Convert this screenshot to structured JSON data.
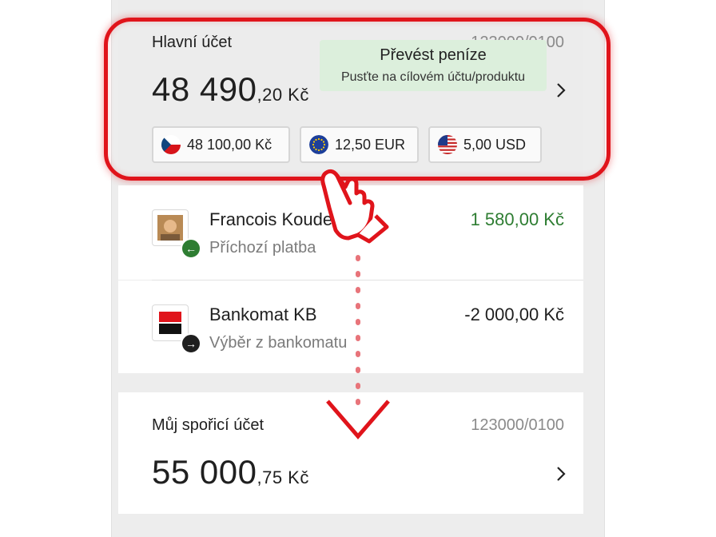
{
  "main_account": {
    "title": "Hlavní účet",
    "number": "123000/0100",
    "amount_int": "48 490",
    "amount_dec": ",20 Kč",
    "currencies": [
      {
        "label": "48 100,00 Kč",
        "flag": "cz-flag-icon"
      },
      {
        "label": "12,50 EUR",
        "flag": "eu-flag-icon"
      },
      {
        "label": "5,00 USD",
        "flag": "us-flag-icon"
      }
    ]
  },
  "tooltip": {
    "title": "Převést peníze",
    "subtitle": "Pusťte na cílovém účtu/produktu"
  },
  "transactions": [
    {
      "name": "Francois Koudel",
      "type": "Příchozí platba",
      "amount": "1 580,00 Kč",
      "amount_color": "#2e7d32",
      "direction": "incoming"
    },
    {
      "name": "Bankomat KB",
      "type": "Výběr z bankomatu",
      "amount": "-2 000,00 Kč",
      "amount_color": "#1f1f1f",
      "direction": "outgoing"
    }
  ],
  "savings_account": {
    "title": "Můj spořicí účet",
    "number": "123000/0100",
    "amount_int": "55 000",
    "amount_dec": ",75 Kč"
  },
  "colors": {
    "accent_red": "#e0141b",
    "incoming_green": "#2e7d32",
    "tooltip_bg": "#dcefdc"
  }
}
